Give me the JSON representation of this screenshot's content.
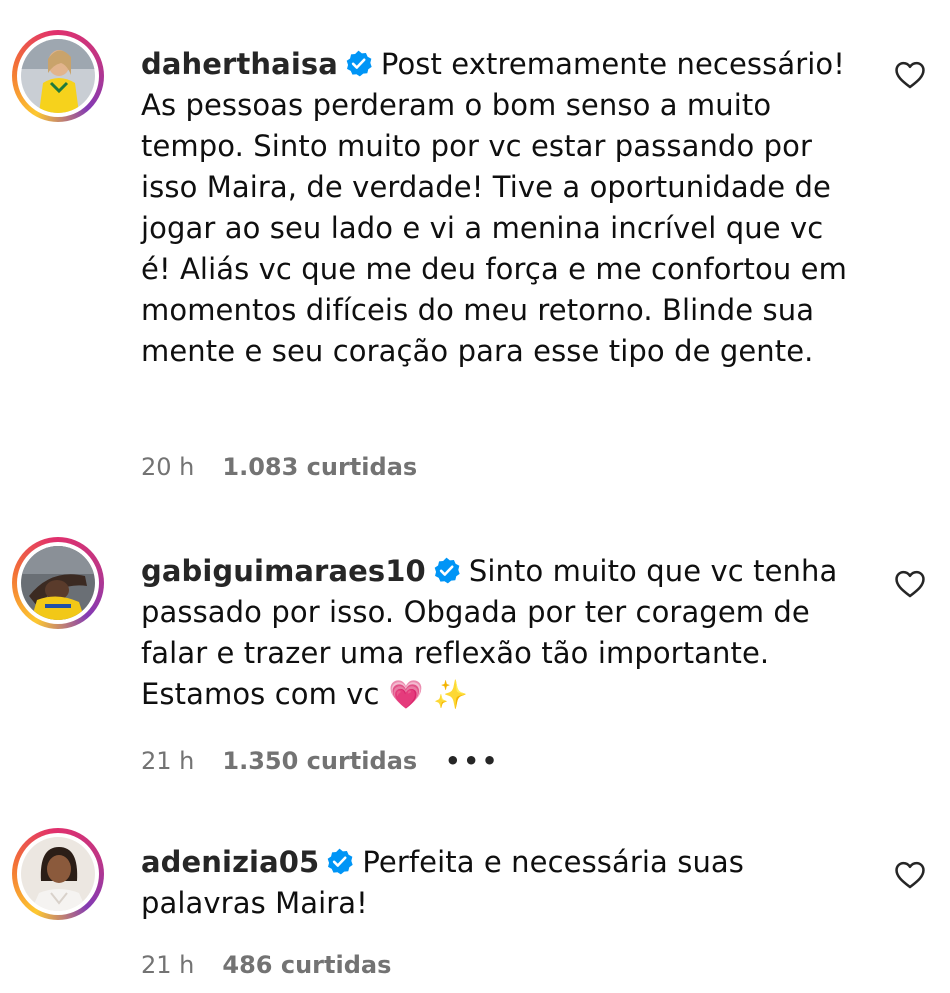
{
  "comments": [
    {
      "username": "daherthaisa",
      "verified": true,
      "text": "Post extremamente necessário! As pessoas perderam o bom senso a muito tempo. Sinto muito por vc estar passando por isso Maira, de verdade! Tive a oportunidade de jogar ao seu lado e vi a menina incrível que vc é! Aliás vc que me deu força e me confortou em momentos difíceis do meu retorno. Blinde sua mente e seu coração para esse tipo de gente.",
      "time": "20 h",
      "likes": "1.083 curtidas"
    },
    {
      "username": "gabiguimaraes10",
      "verified": true,
      "text": "Sinto muito que vc tenha passado por isso. Obgada por ter coragem de falar e trazer uma reflexão tão importante. Estamos com vc",
      "emojis": [
        "💗",
        "✨"
      ],
      "time": "21 h",
      "likes": "1.350 curtidas",
      "more_label": "•••"
    },
    {
      "username": "adenizia05",
      "verified": true,
      "text": "Perfeita e necessária suas palavras Maira!",
      "time": "21 h",
      "likes": "486 curtidas"
    }
  ],
  "icons": {
    "verified": "verified-badge-icon",
    "like": "heart-outline-icon"
  },
  "colors": {
    "verified_blue": "#0095f6",
    "meta_gray": "#737373",
    "text": "#0f0f0f"
  }
}
